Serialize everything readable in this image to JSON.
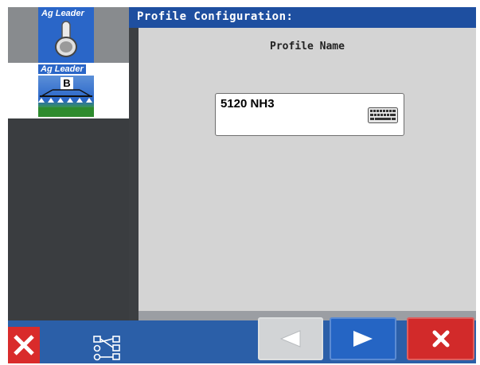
{
  "sidebar": {
    "tiles": [
      {
        "brand": "Ag Leader",
        "icon": "toggle-switch-icon"
      },
      {
        "brand": "Ag Leader",
        "icon": "sprayer-boom-icon",
        "badge_letter": "B"
      }
    ],
    "close_icon": "close-icon",
    "tree_icon": "tree-config-icon"
  },
  "header": {
    "title": "Profile Configuration:"
  },
  "form": {
    "field_label": "Profile Name",
    "field_value": "5120 NH3",
    "keyboard_icon": "keyboard-icon"
  },
  "nav": {
    "prev_icon": "arrow-left-icon",
    "next_icon": "arrow-right-icon",
    "cancel_icon": "close-icon"
  },
  "colors": {
    "header_bg": "#1e4fa0",
    "bottom_bar_bg": "#2b5fa8",
    "content_bg": "#d4d4d4",
    "next_button": "#2565c4",
    "cancel_button": "#d22a2a"
  }
}
